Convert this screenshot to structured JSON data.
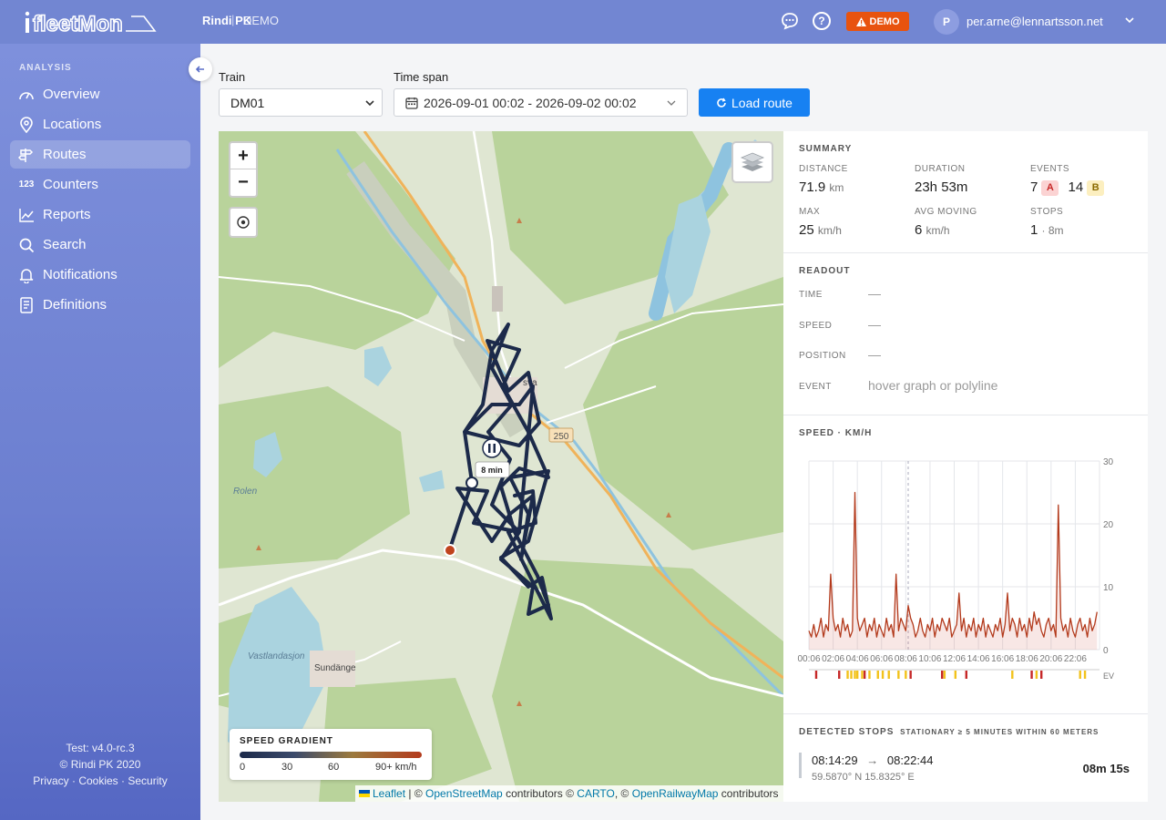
{
  "app": {
    "logo_text": "fleetMon",
    "org": "Rindi PK",
    "separator": "|",
    "env": "DEMO"
  },
  "header": {
    "demo_badge": "DEMO",
    "user_initial": "P",
    "user_email": "per.arne@lennartsson.net"
  },
  "sidebar": {
    "section_title": "ANALYSIS",
    "items": [
      {
        "label": "Overview",
        "icon": "gauge-icon"
      },
      {
        "label": "Locations",
        "icon": "map-pin-icon"
      },
      {
        "label": "Routes",
        "icon": "signpost-icon",
        "active": true
      },
      {
        "label": "Counters",
        "icon": "numbers-icon",
        "icon_text": "123"
      },
      {
        "label": "Reports",
        "icon": "chart-line-icon"
      },
      {
        "label": "Search",
        "icon": "search-icon"
      },
      {
        "label": "Notifications",
        "icon": "bell-icon"
      },
      {
        "label": "Definitions",
        "icon": "document-list-icon"
      }
    ],
    "footer": {
      "version": "Test: v4.0-rc.3",
      "copyright": "© Rindi PK 2020",
      "privacy": "Privacy",
      "cookies": "Cookies",
      "security": "Security",
      "dot": "·"
    }
  },
  "controls": {
    "train_label": "Train",
    "train_value": "DM01",
    "timespan_label": "Time span",
    "timespan_value": "2026-09-01 00:02 - 2026-09-02 00:02",
    "load_button": "Load route"
  },
  "map": {
    "zoom_in": "+",
    "zoom_out": "−",
    "labels": {
      "town": "sva",
      "road": "250",
      "lake1": "Rolen",
      "lake2": "Vastlandasjon",
      "town2": "Sundänge"
    },
    "stop_marker": "8 min",
    "legend": {
      "title": "SPEED GRADIENT",
      "ticks": [
        "0",
        "30",
        "60",
        "90+ km/h"
      ]
    },
    "attribution": {
      "leaflet": "Leaflet",
      "sep1": "| ©",
      "osm": "OpenStreetMap",
      "mid1": "contributors ©",
      "carto": "CARTO",
      "mid2": ", ©",
      "orm": "OpenRailwayMap",
      "end": "contributors"
    }
  },
  "summary": {
    "title": "SUMMARY",
    "distance": {
      "label": "DISTANCE",
      "value": "71.9",
      "unit": "km"
    },
    "duration": {
      "label": "DURATION",
      "value": "23h 53m"
    },
    "events": {
      "label": "EVENTS",
      "a_count": "7",
      "a_badge": "A",
      "b_count": "14",
      "b_badge": "B"
    },
    "max": {
      "label": "MAX",
      "value": "25",
      "unit": "km/h"
    },
    "avg_moving": {
      "label": "AVG MOVING",
      "value": "6",
      "unit": "km/h"
    },
    "stops": {
      "label": "STOPS",
      "value": "1",
      "detail": "· 8m"
    }
  },
  "readout": {
    "title": "READOUT",
    "time_label": "TIME",
    "time_value": "—",
    "speed_label": "SPEED",
    "speed_value": "—",
    "position_label": "POSITION",
    "position_value": "—",
    "event_label": "EVENT",
    "event_value": "hover graph or polyline"
  },
  "chart_data": {
    "type": "line",
    "title": "SPEED · KM/H",
    "ylim": [
      0,
      30
    ],
    "yticks": [
      "0",
      "10",
      "20",
      "30"
    ],
    "xticks": [
      "00:06",
      "02:06",
      "04:06",
      "06:06",
      "08:06",
      "10:06",
      "12:06",
      "14:06",
      "16:06",
      "18:06",
      "20:06",
      "22:06"
    ],
    "x": [
      0,
      0.2,
      0.4,
      0.6,
      0.8,
      1.0,
      1.2,
      1.4,
      1.6,
      1.8,
      2.0,
      2.2,
      2.4,
      2.6,
      2.8,
      3.0,
      3.2,
      3.4,
      3.6,
      3.8,
      4.0,
      4.2,
      4.4,
      4.6,
      4.8,
      5.0,
      5.2,
      5.4,
      5.6,
      5.8,
      6.0,
      6.2,
      6.4,
      6.6,
      6.8,
      7.0,
      7.2,
      7.4,
      7.6,
      7.8,
      8.0,
      8.2,
      8.4,
      8.6,
      8.8,
      9.0,
      9.2,
      9.4,
      9.6,
      9.8,
      10.0,
      10.2,
      10.4,
      10.6,
      10.8,
      11.0,
      11.2,
      11.4,
      11.6,
      11.8,
      12.0,
      12.2,
      12.4,
      12.6,
      12.8,
      13.0,
      13.2,
      13.4,
      13.6,
      13.8,
      14.0,
      14.2,
      14.4,
      14.6,
      14.8,
      15.0,
      15.2,
      15.4,
      15.6,
      15.8,
      16.0,
      16.2,
      16.4,
      16.6,
      16.8,
      17.0,
      17.2,
      17.4,
      17.6,
      17.8,
      18.0,
      18.2,
      18.4,
      18.6,
      18.8,
      19.0,
      19.2,
      19.4,
      19.6,
      19.8,
      20.0,
      20.2,
      20.4,
      20.6,
      20.8,
      21.0,
      21.2,
      21.4,
      21.6,
      21.8,
      22.0,
      22.2,
      22.4,
      22.6,
      22.8,
      23.0,
      23.2,
      23.4,
      23.6,
      23.8
    ],
    "values": [
      3,
      2,
      4,
      2,
      3,
      5,
      2,
      4,
      3,
      12,
      5,
      3,
      4,
      2,
      5,
      3,
      4,
      2,
      3,
      25,
      5,
      3,
      4,
      5,
      2,
      4,
      3,
      5,
      2,
      4,
      3,
      2,
      5,
      3,
      4,
      2,
      12,
      3,
      5,
      4,
      3,
      7,
      5,
      4,
      2,
      3,
      5,
      3,
      2,
      4,
      3,
      5,
      2,
      4,
      3,
      5,
      4,
      3,
      5,
      2,
      3,
      4,
      9,
      3,
      5,
      2,
      4,
      3,
      5,
      2,
      4,
      3,
      5,
      2,
      4,
      3,
      2,
      4,
      3,
      5,
      2,
      4,
      9,
      3,
      5,
      4,
      2,
      5,
      3,
      4,
      2,
      5,
      3,
      6,
      4,
      5,
      3,
      2,
      4,
      5,
      3,
      4,
      2,
      23,
      5,
      3,
      4,
      2,
      5,
      3,
      2,
      4,
      5,
      3,
      4,
      2,
      5,
      3,
      4,
      6
    ],
    "ev_label": "EV",
    "events_a": [
      0.6,
      2.5,
      4.6,
      8.4,
      11.0,
      13.0,
      18.4,
      19.2
    ],
    "events_b": [
      3.2,
      3.5,
      3.8,
      4.0,
      4.4,
      5.0,
      5.7,
      6.1,
      6.6,
      7.4,
      8.0,
      11.2,
      12.1,
      16.8,
      18.8,
      22.4,
      22.8
    ]
  },
  "stops_section": {
    "title": "DETECTED STOPS",
    "subtitle": "STATIONARY ≥ 5 MINUTES WITHIN 60 METERS",
    "rows": [
      {
        "from": "08:14:29",
        "arrow": "→",
        "to": "08:22:44",
        "coords": "59.5870° N 15.8325° E",
        "duration": "08m 15s"
      }
    ]
  },
  "colors": {
    "topbar": "#7286d2",
    "accent": "#1781f2",
    "demo": "#e8530f",
    "route": "#1c2a4a",
    "speed_line": "#b33a1c",
    "event_a": "#c62828",
    "event_b": "#f2c21b"
  }
}
